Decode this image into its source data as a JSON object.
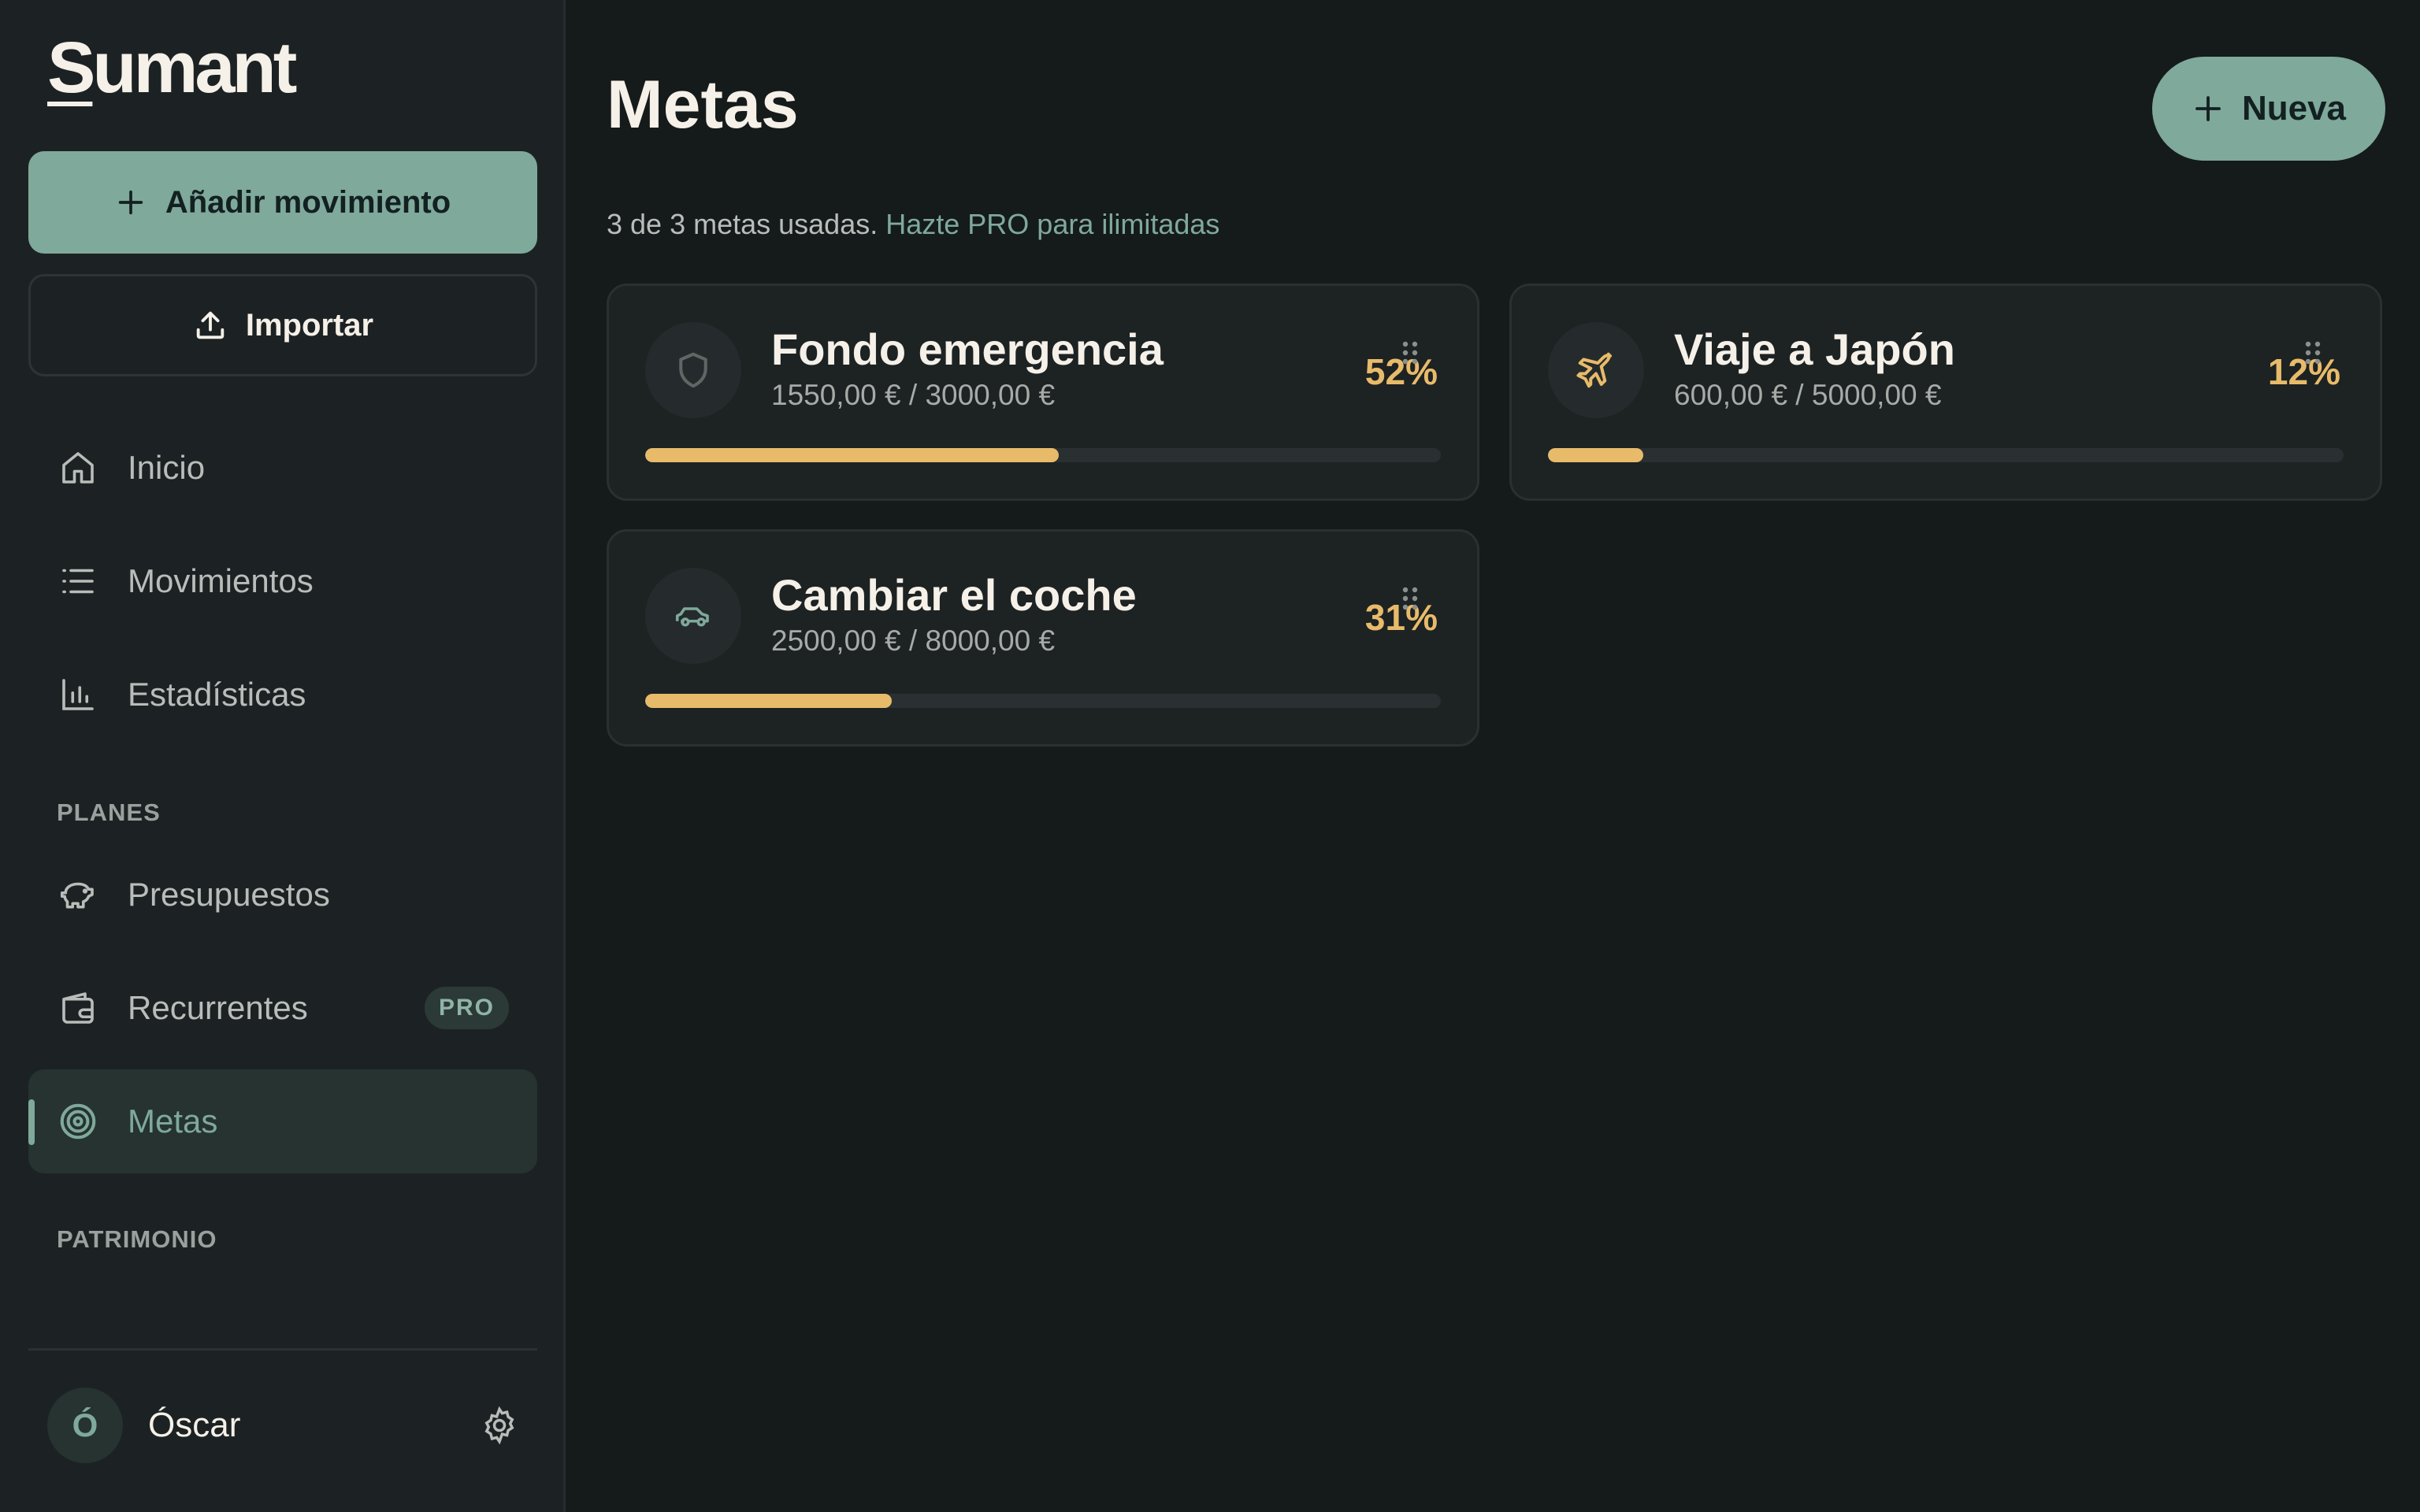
{
  "app": {
    "logo_u": "S",
    "logo_rest": "umant"
  },
  "sidebar": {
    "add_label": "Añadir movimiento",
    "import_label": "Importar",
    "nav": [
      {
        "label": "Inicio",
        "icon": "home-icon"
      },
      {
        "label": "Movimientos",
        "icon": "list-icon"
      },
      {
        "label": "Estadísticas",
        "icon": "bar-chart-icon"
      }
    ],
    "section_planes": "PLANES",
    "plans": [
      {
        "label": "Presupuestos",
        "icon": "piggy-bank-icon"
      },
      {
        "label": "Recurrentes",
        "icon": "wallet-icon",
        "badge": "PRO"
      },
      {
        "label": "Metas",
        "icon": "target-icon",
        "active": true
      }
    ],
    "section_patrimonio": "PATRIMONIO",
    "user": {
      "initial": "Ó",
      "name": "Óscar"
    }
  },
  "main": {
    "title": "Metas",
    "new_label": "Nueva",
    "usage_text": "3 de 3 metas usadas.",
    "usage_link": "Hazte PRO para ilimitadas",
    "goals": [
      {
        "name": "Fondo emergencia",
        "amounts": "1550,00 € / 3000,00 €",
        "percent_label": "52%",
        "progress": 0.52,
        "icon": "shield-icon"
      },
      {
        "name": "Viaje a Japón",
        "amounts": "600,00 € / 5000,00 €",
        "percent_label": "12%",
        "progress": 0.12,
        "icon": "plane-icon"
      },
      {
        "name": "Cambiar el coche",
        "amounts": "2500,00 € / 8000,00 €",
        "percent_label": "31%",
        "progress": 0.31,
        "icon": "car-icon"
      }
    ]
  },
  "colors": {
    "accent": "#7fa99a",
    "progress": "#e8bb6a",
    "background": "#151a1b",
    "sidebar": "#1c2223"
  }
}
